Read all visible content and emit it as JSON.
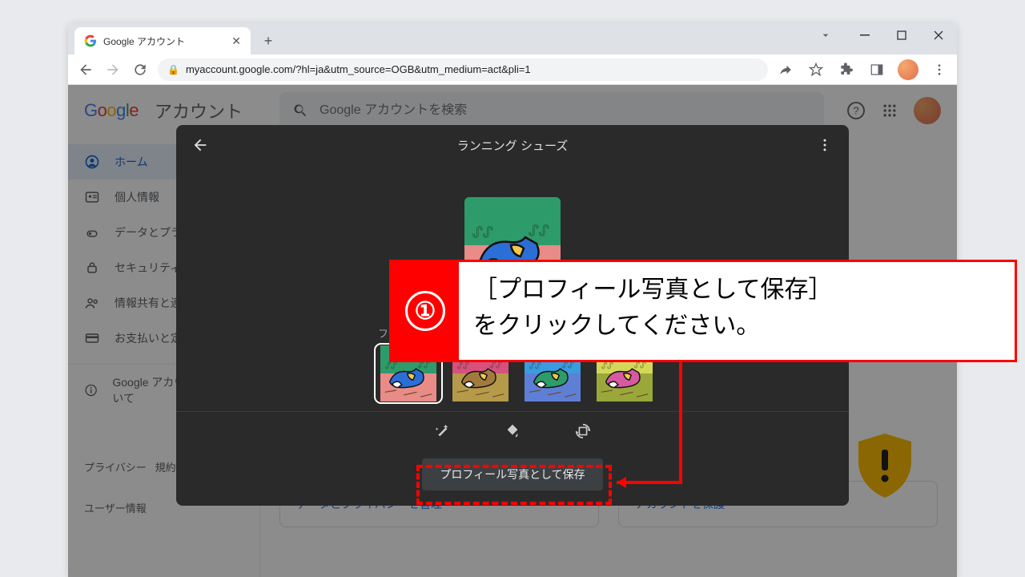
{
  "browser": {
    "tab_title": "Google アカウント",
    "url": "myaccount.google.com/?hl=ja&utm_source=OGB&utm_medium=act&pli=1"
  },
  "header": {
    "logo_account_word": "アカウント",
    "search_placeholder": "Google アカウントを検索"
  },
  "sidebar": {
    "items": [
      {
        "label": "ホーム"
      },
      {
        "label": "個人情報"
      },
      {
        "label": "データとプライバシー"
      },
      {
        "label": "セキュリティ"
      },
      {
        "label": "情報共有と連絡先"
      },
      {
        "label": "お支払いと定期購入"
      }
    ],
    "about_label": "Google アカウントについて",
    "lower": [
      {
        "label": "プライバシー"
      },
      {
        "label": "規約"
      },
      {
        "label": "ユーザー情報"
      }
    ]
  },
  "cards": {
    "left_link": "データとプライバシーを管理",
    "right_link": "アカウントを保護"
  },
  "modal": {
    "title": "ランニング シューズ",
    "filter_label": "フィルタ",
    "save_button": "プロフィール写真として保存",
    "filters": [
      {
        "bg_top": "#2e9b6b",
        "bg_bot": "#e98b87",
        "shoe": "#2b6fd6"
      },
      {
        "bg_top": "#d6517e",
        "bg_bot": "#b59a4a",
        "shoe": "#a37a3e"
      },
      {
        "bg_top": "#3a9be0",
        "bg_bot": "#5e7fd6",
        "shoe": "#2e9b6b"
      },
      {
        "bg_top": "#d4d85a",
        "bg_bot": "#9aa83a",
        "shoe": "#d65aa0"
      }
    ]
  },
  "annotation": {
    "number": "①",
    "text_line1_open": "［",
    "text_line1_body": "プロフィール写真として保存",
    "text_line1_close": "］",
    "text_line2": "をクリックしてください。"
  }
}
